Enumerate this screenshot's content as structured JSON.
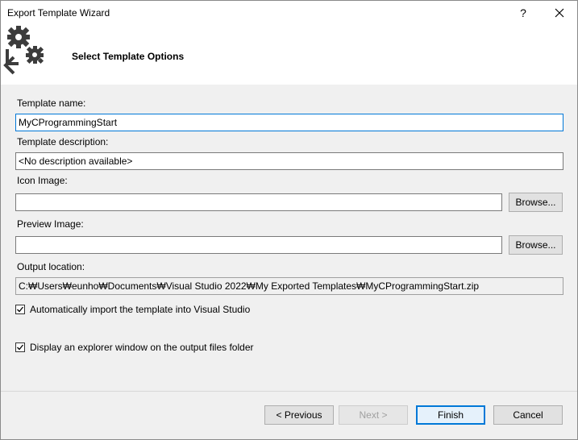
{
  "window": {
    "title": "Export Template Wizard",
    "help_glyph": "?",
    "close_glyph": "✕"
  },
  "header": {
    "title": "Select Template Options",
    "icon": "gears-export-icon"
  },
  "form": {
    "template_name_label": "Template name:",
    "template_name_value": "MyCProgrammingStart",
    "template_description_label": "Template description:",
    "template_description_value": "<No description available>",
    "icon_image_label": "Icon Image:",
    "icon_image_value": "",
    "icon_browse_label": "Browse...",
    "preview_image_label": "Preview Image:",
    "preview_image_value": "",
    "preview_browse_label": "Browse...",
    "output_location_label": "Output location:",
    "output_location_value": "C:₩Users₩eunho₩Documents₩Visual Studio 2022₩My Exported Templates₩MyCProgrammingStart.zip",
    "auto_import_label": "Automatically import the template into Visual Studio",
    "auto_import_checked": true,
    "display_explorer_label": "Display an explorer window on the output files folder",
    "display_explorer_checked": true
  },
  "footer": {
    "previous_label": "< Previous",
    "next_label": "Next >",
    "finish_label": "Finish",
    "cancel_label": "Cancel"
  },
  "colors": {
    "accent": "#0078d7",
    "dialog_bg": "#f0f0f0"
  }
}
